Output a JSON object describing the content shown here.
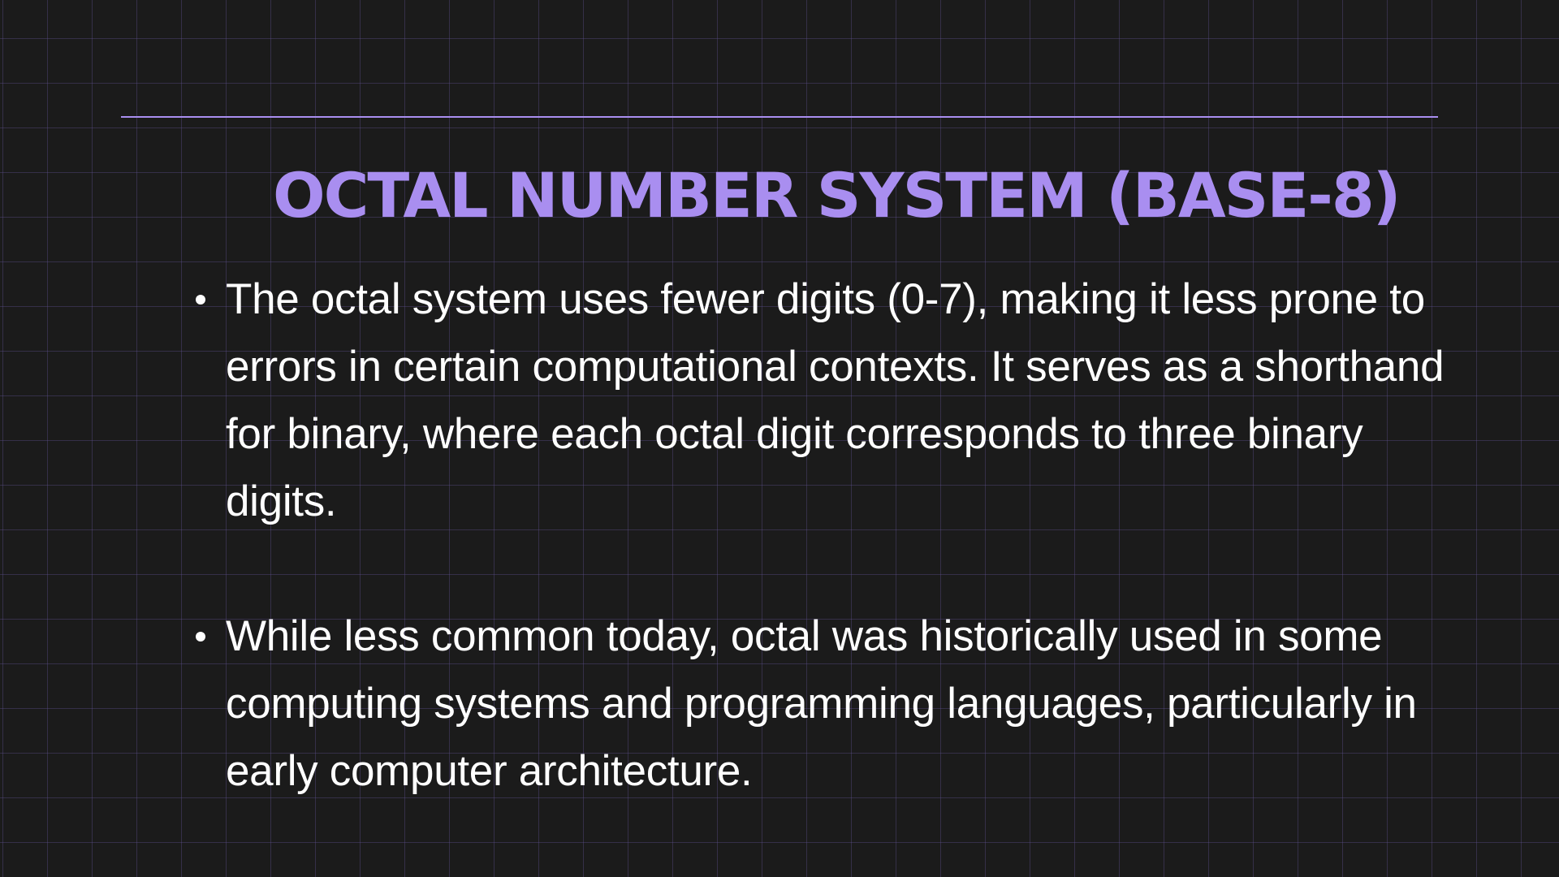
{
  "slide": {
    "title": "OCTAL NUMBER SYSTEM (BASE-8)",
    "bullets": [
      "The octal system uses fewer digits (0-7), making it less prone to errors in certain computational contexts. It serves as a shorthand for binary, where each octal digit corresponds to three binary digits.",
      "While less common today, octal was historically used in some computing systems and programming languages, particularly in early computer architecture."
    ]
  },
  "colors": {
    "background": "#1b1b1b",
    "accent": "#a98ef0",
    "text": "#ffffff",
    "grid": "#5f5091"
  }
}
